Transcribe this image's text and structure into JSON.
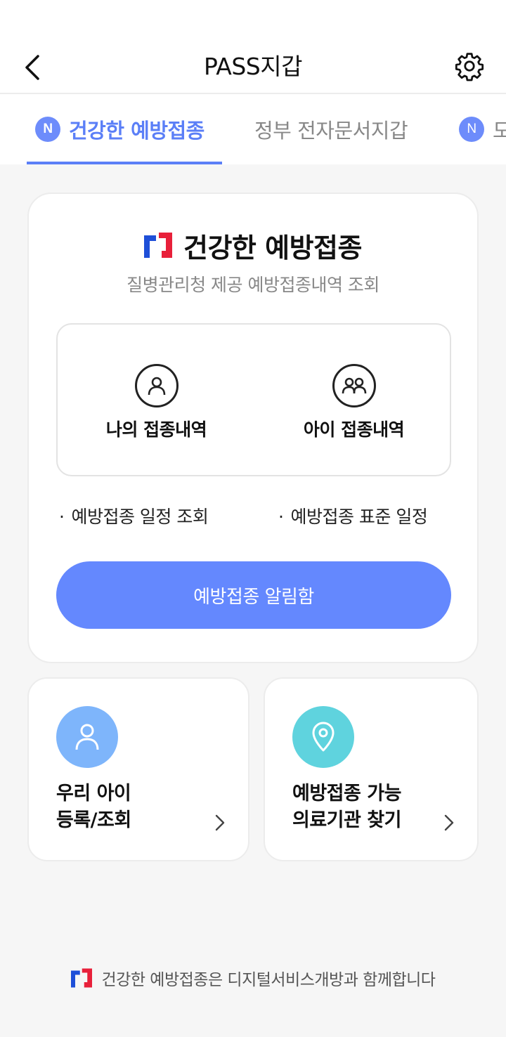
{
  "header": {
    "title": "PASS지갑"
  },
  "tabs": [
    {
      "label": "건강한 예방접종",
      "badge": "N",
      "active": true
    },
    {
      "label": "정부 전자문서지갑",
      "badge": "",
      "active": false
    },
    {
      "label": "도",
      "badge": "N",
      "active": false
    }
  ],
  "main_card": {
    "title": "건강한 예방접종",
    "subtitle": "질병관리청 제공 예방접종내역 조회",
    "history": [
      {
        "label": "나의 접종내역",
        "icon": "person-icon"
      },
      {
        "label": "아이 접종내역",
        "icon": "people-icon"
      }
    ],
    "links": [
      {
        "bullet": "·",
        "label": "예방접종 일정 조회"
      },
      {
        "bullet": "·",
        "label": "예방접종 표준 일정"
      }
    ],
    "notify_button": "예방접종 알림함"
  },
  "sub_cards": [
    {
      "line1": "우리 아이",
      "line2": "등록/조회",
      "icon": "person-icon",
      "color": "#7eb5fb"
    },
    {
      "line1": "예방접종 가능",
      "line2": "의료기관 찾기",
      "icon": "location-pin-icon",
      "color": "#5fd3de"
    }
  ],
  "footer": {
    "text": "건강한 예방접종은 디지털서비스개방과 함께합니다"
  },
  "colors": {
    "accent": "#5b7ff7",
    "button": "#6488fe",
    "logo_blue": "#1e4fd8",
    "logo_red": "#e8203a"
  }
}
